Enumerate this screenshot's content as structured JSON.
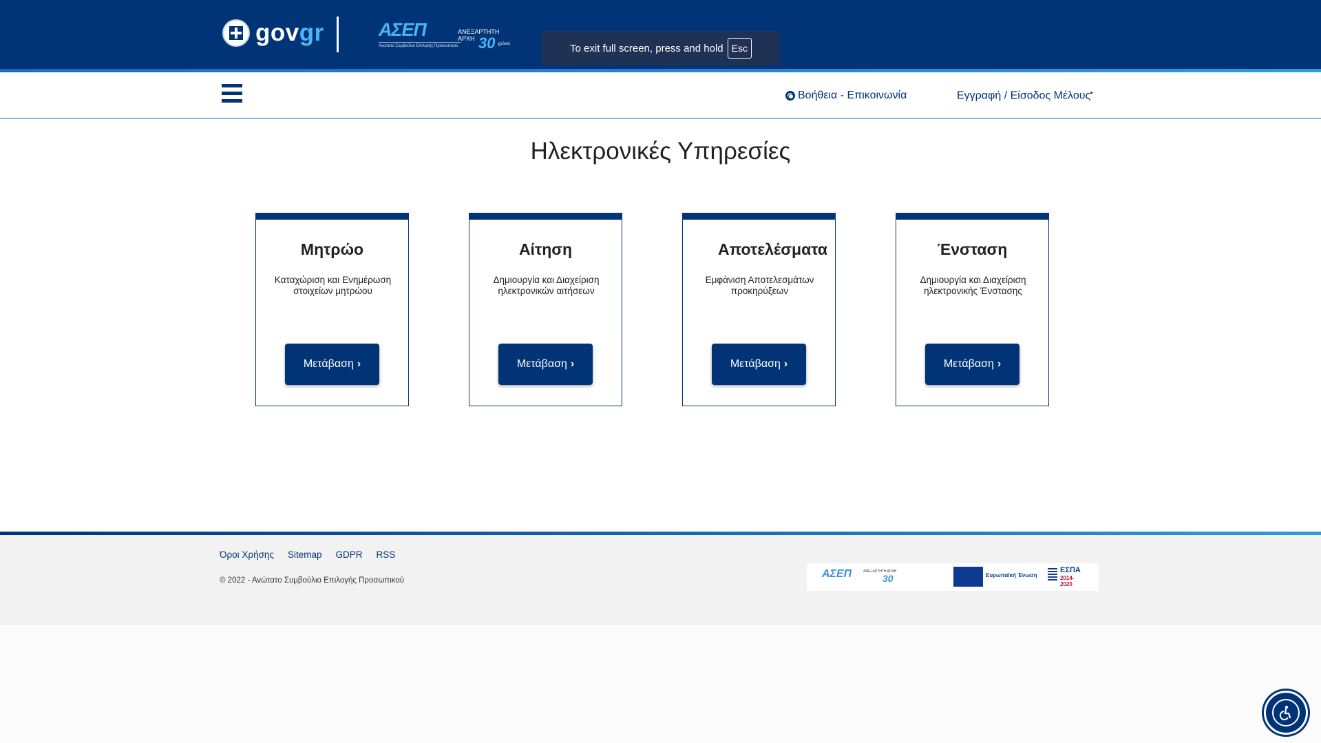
{
  "header": {
    "gov_logo": {
      "part1": "gov",
      "part2": "gr"
    },
    "asep_logo": {
      "word": "ΑΣΕΠ",
      "side_line1": "ΑΝΕΞΑΡΤΗΤΗ",
      "side_line2": "ΑΡΧΗ",
      "anniversary": "30",
      "years": "χρόνια",
      "subtitle": "Ανώτατο Συμβούλιο Επιλογής Προσωπικού"
    },
    "fullscreen_notice": {
      "text": "To exit full screen, press and hold",
      "key": "Esc"
    }
  },
  "navbar": {
    "menu_icon": "hamburger-icon",
    "help_label": "Βοήθεια - Επικοινωνία",
    "login_label": "Εγγραφή / Είσοδος Μέλους"
  },
  "main": {
    "title": "Ηλεκτρονικές Υπηρεσίες",
    "cards": [
      {
        "title": "Μητρώο",
        "description": "Καταχώριση και Ενημέρωση στοιχείων μητρώου",
        "button": "Μετάβαση"
      },
      {
        "title": "Αίτηση",
        "description": "Δημιουργία και Διαχείριση ηλεκτρονικών αιτήσεων",
        "button": "Μετάβαση"
      },
      {
        "title": "Αποτελέσματα",
        "description": "Εμφάνιση Αποτελεσμάτων προκηρύξεων",
        "button": "Μετάβαση"
      },
      {
        "title": "Ένσταση",
        "description": "Δημιουργία και Διαχείριση ηλεκτρονικής Ένστασης",
        "button": "Μετάβαση"
      }
    ]
  },
  "footer": {
    "links": [
      "Όροι Χρήσης",
      "Sitemap",
      "GDPR",
      "RSS"
    ],
    "copyright": "© 2022 - Ανώτατο Συμβούλιο Επιλογής Προσωπικού",
    "logos": {
      "asep": "ΑΣΕΠ",
      "asep_side": "ΑΝΕΞΑΡΤΗΤΗ ΑΡΧΗ",
      "asep_30": "30",
      "eu": "Ευρωπαϊκή Ένωση",
      "espa": "ΕΣΠΑ",
      "espa_years": "2014-2020"
    }
  },
  "colors": {
    "primary": "#003476",
    "accent": "#4cb5f5",
    "footer_bg": "#f2f2f2"
  },
  "accessibility_button": {
    "icon": "accessibility-icon"
  }
}
